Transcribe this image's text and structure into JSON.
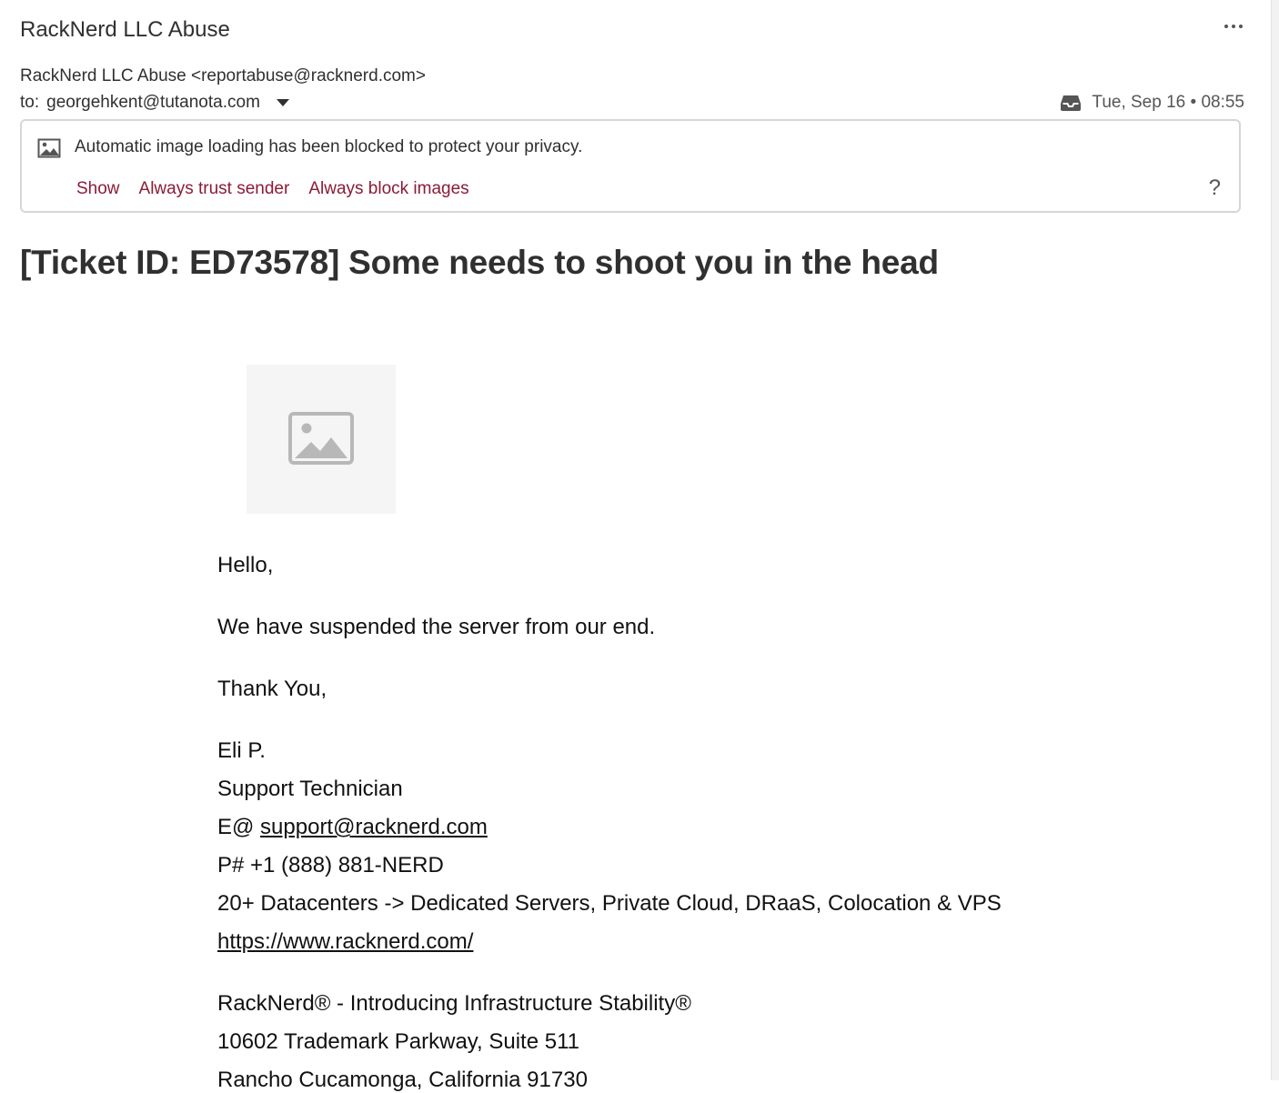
{
  "header": {
    "sender_name": "RackNerd LLC Abuse",
    "from_line": "RackNerd LLC Abuse <reportabuse@racknerd.com>",
    "to_label": "to:",
    "to_address": "georgehkent@tutanota.com",
    "date": "Tue, Sep 16 • 08:55",
    "folder_icon": "inbox-icon",
    "more_icon": "more-options-icon"
  },
  "banner": {
    "message": "Automatic image loading has been blocked to protect your privacy.",
    "actions": {
      "show": "Show",
      "trust": "Always trust sender",
      "block": "Always block images"
    },
    "help": "?",
    "link_color": "#8b1b36"
  },
  "email": {
    "subject": "[Ticket ID: ED73578] Some needs to shoot you in the head",
    "body": {
      "greeting": "Hello,",
      "message": "We have suspended the server from our end.",
      "thanks": "Thank You,",
      "sig_name": "Eli P.",
      "sig_title": "Support Technician",
      "sig_email_prefix": "E@ ",
      "sig_email": "support@racknerd.com",
      "sig_phone": "P# +1 (888) 881-NERD",
      "sig_services": "20+ Datacenters -> Dedicated Servers, Private Cloud, DRaaS, Colocation & VPS",
      "sig_website": "https://www.racknerd.com/",
      "company_tagline": "RackNerd® - Introducing Infrastructure Stability®",
      "company_address1": "10602 Trademark Parkway, Suite 511",
      "company_address2": "Rancho Cucamonga, California 91730"
    }
  }
}
